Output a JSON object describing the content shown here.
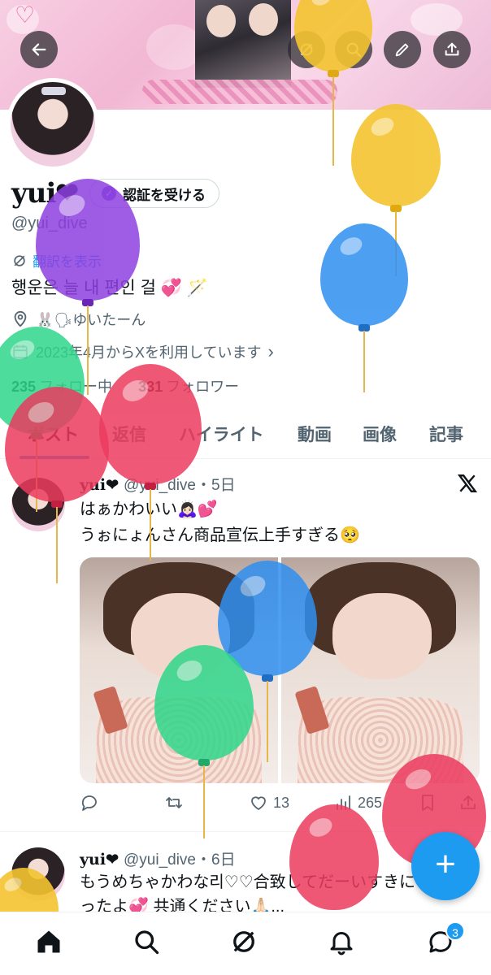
{
  "header": {
    "back_label": "back",
    "icons": [
      "grok-icon",
      "search-icon",
      "edit-icon",
      "share-icon"
    ]
  },
  "profile": {
    "name": "yui❤",
    "verify_button": "認証を受ける",
    "handle": "@yui_dive",
    "translate_label": "翻訳を表示",
    "bio": "행운은 늘 내 편인 걸 💞 🪄",
    "location": "🐰🗣ゆいたーん",
    "joined": "2023年4月からXを利用しています",
    "following_count": "235",
    "following_label": "フォロー中",
    "followers_count": "331",
    "followers_label": "フォロワー"
  },
  "tabs": [
    {
      "label": "ポスト",
      "active": true
    },
    {
      "label": "返信"
    },
    {
      "label": "ハイライト"
    },
    {
      "label": "動画"
    },
    {
      "label": "画像"
    },
    {
      "label": "記事"
    }
  ],
  "posts": [
    {
      "name": "yui❤",
      "meta": "@yui_dive・5日",
      "lines": [
        "はぁかわいい🙇🏻‍♀️💕",
        "うぉにょんさん商品宣伝上手すぎる🥺"
      ],
      "replies": "",
      "reposts": "",
      "likes": "13",
      "views": "265"
    },
    {
      "name": "yui❤",
      "meta": "@yui_dive・6日",
      "lines": [
        "もうめちゃかわな리♡♡合致してだーいすきにな",
        "ったよ💞 共通ください🙏🏻..."
      ]
    }
  ],
  "fab_label": "+",
  "bottom_nav": {
    "items": [
      "home-icon",
      "search-icon",
      "grok-icon",
      "bell-icon",
      "messages-icon"
    ],
    "messages_badge": "3"
  },
  "colors": {
    "accent": "#1d9bf0",
    "balloon_purple": "#8e3fe0",
    "balloon_yellow": "#f4c430",
    "balloon_blue": "#2f8ff0",
    "balloon_green": "#2fd68a",
    "balloon_red": "#ec3b5e"
  }
}
